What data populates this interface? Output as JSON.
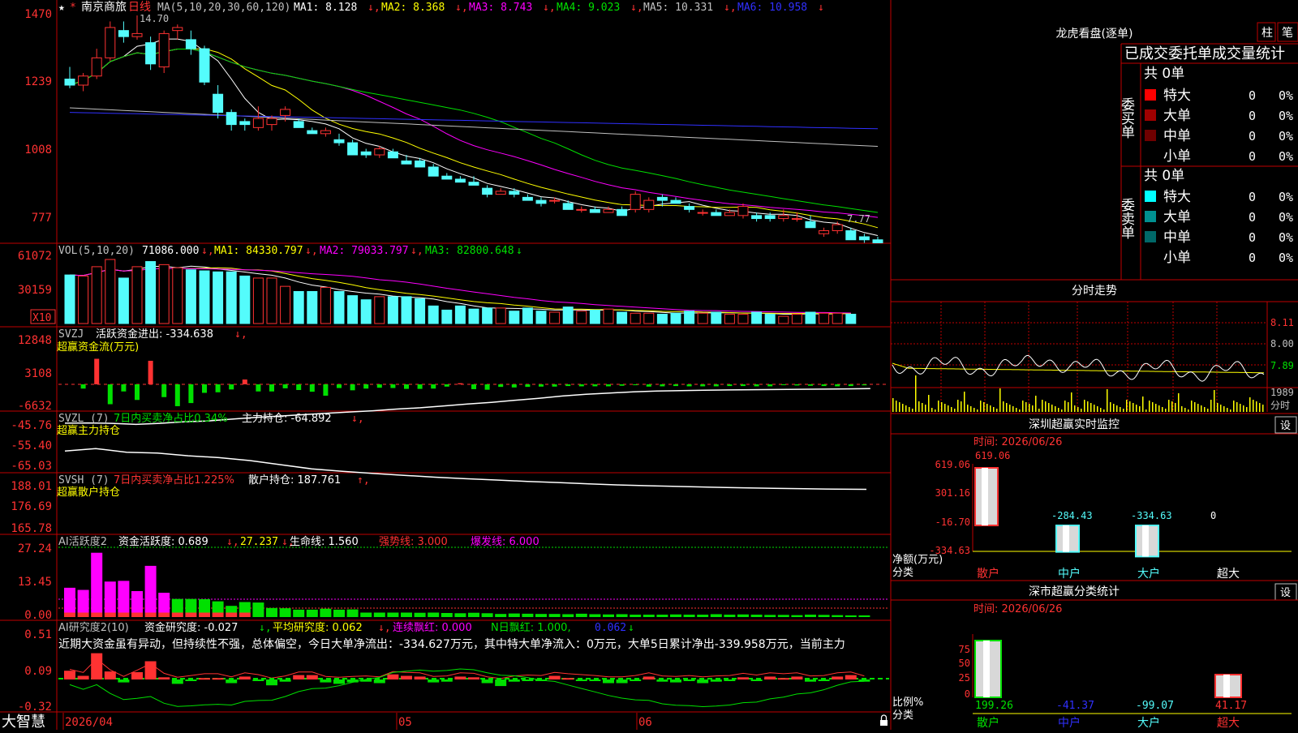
{
  "colors": {
    "up": "#ff3232",
    "down": "#54fcfc",
    "grid": "#c00000",
    "ma1": "#ffffff",
    "ma2": "#ffff00",
    "ma3": "#ff00ff",
    "ma4": "#00e000",
    "ma5": "#c0c0c0",
    "ma6": "#3030ff"
  },
  "stock": {
    "name": "南京商旅",
    "period": "日线"
  },
  "price_panel": {
    "header_prefix": "MA(5,10,20,30,60,120)",
    "ma_labels": [
      "MA1: 8.128",
      "MA2: 8.368",
      "MA3: 8.743",
      "MA4: 9.023",
      "MA5: 10.331",
      "MA6: 10.958"
    ],
    "ticks": [
      "1470",
      "1239",
      "1008",
      "777"
    ],
    "high_label": "14.70",
    "low_label": "7.77"
  },
  "vol_panel": {
    "header": "VOL(5,10,20)",
    "value": "71086.000",
    "ma_labels": [
      "MA1: 84330.797",
      "MA2: 79033.797",
      "MA3: 82800.648"
    ],
    "ticks": [
      "61072",
      "30159"
    ],
    "unit": "X10"
  },
  "svzj_panel": {
    "header": "SVZJ",
    "label": "活跃资金进出: -334.638",
    "sub": "超赢资金流(万元)",
    "ticks": [
      "12848",
      "3108",
      "-6632"
    ]
  },
  "svzl_panel": {
    "header": "SVZL (7)",
    "label1": "7日内买卖净占比0.34%",
    "label2": "主力持仓: -64.892",
    "sub": "超赢主力持仓",
    "ticks": [
      "-45.76",
      "-55.40",
      "-65.03"
    ]
  },
  "svsh_panel": {
    "header": "SVSH (7)",
    "label1": "7日内买卖净占比1.225%",
    "label2": "散户持仓: 187.761",
    "sub": "超赢散户持仓",
    "ticks": [
      "188.01",
      "176.69",
      "165.78"
    ]
  },
  "ai_active_panel": {
    "header": "AI活跃度2",
    "label1": "资金活跃度: 0.689",
    "label2": "27.237",
    "label3": "生命线: 1.560",
    "label4": "强势线: 3.000",
    "label5": "爆发线: 6.000",
    "ticks": [
      "27.24",
      "13.45",
      "0.00"
    ]
  },
  "ai_research_panel": {
    "header": "AI研究度2(10)",
    "label1": "资金研究度: -0.027",
    "label2": "平均研究度: 0.062",
    "label3": "连续飘红: 0.000",
    "label4": "N日飘红: 1.000,",
    "label5": "0.062",
    "text": "近期大资金虽有异动，但持续性不强，总体偏空，今日大单净流出：-334.627万元，其中特大单净流入：0万元，大单5日累计净出-339.958万元，当前主力",
    "ticks": [
      "0.51",
      "0.09",
      "-0.32"
    ]
  },
  "date_axis": {
    "labels": [
      "2026/04",
      "05",
      "06"
    ]
  },
  "footer": {
    "brand": "大智慧"
  },
  "dragon": {
    "title": "龙虎看盘(逐单)",
    "btn_col": "柱",
    "btn_pen": "笔",
    "table_title": "已成交委托单成交量统计",
    "buy": {
      "side_label": "委买单",
      "total": "共 0单",
      "rows": [
        {
          "label": "特大",
          "count": "0",
          "pct": "0%",
          "color": "#ff0000"
        },
        {
          "label": "大单",
          "count": "0",
          "pct": "0%",
          "color": "#a00000"
        },
        {
          "label": "中单",
          "count": "0",
          "pct": "0%",
          "color": "#700000"
        },
        {
          "label": "小单",
          "count": "0",
          "pct": "0%",
          "color": ""
        }
      ]
    },
    "sell": {
      "side_label": "委卖单",
      "total": "共 0单",
      "rows": [
        {
          "label": "特大",
          "count": "0",
          "pct": "0%",
          "color": "#00ffff"
        },
        {
          "label": "大单",
          "count": "0",
          "pct": "0%",
          "color": "#009090"
        },
        {
          "label": "中单",
          "count": "0",
          "pct": "0%",
          "color": "#006868"
        },
        {
          "label": "小单",
          "count": "0",
          "pct": "0%",
          "color": ""
        }
      ]
    }
  },
  "intraday": {
    "title": "分时走势",
    "ticks": [
      "8.11",
      "8.00",
      "7.89"
    ],
    "vol_tick": "1989",
    "vol_unit": "分时"
  },
  "monitor": {
    "title": "深圳超赢实时监控",
    "btn": "设",
    "date": "时间: 2026/06/26",
    "y_ticks": [
      "619.06",
      "301.16",
      "-16.70",
      "-334.63"
    ],
    "y_label": "净额(万元)",
    "x_label": "分类",
    "categories": [
      "散户",
      "中户",
      "大户",
      "超大"
    ],
    "values": [
      619.06,
      -284.43,
      -334.63,
      0
    ],
    "value_labels": [
      "619.06",
      "-284.43",
      "-334.63",
      "0"
    ]
  },
  "classify": {
    "title": "深市超赢分类统计",
    "btn": "设",
    "date": "时间: 2026/06/26",
    "y_ticks": [
      "75",
      "50",
      "25",
      "0"
    ],
    "y_label": "比例%",
    "x_label": "分类",
    "categories": [
      "散户",
      "中户",
      "大户",
      "超大"
    ],
    "bars": [
      100,
      0,
      0,
      40
    ],
    "value_labels": [
      "199.26",
      "-41.37",
      "-99.07",
      "41.17"
    ]
  },
  "chart_data": [
    {
      "type": "candlestick",
      "title": "南京商旅 日线",
      "y_unit": "price (tick labels scaled x100)",
      "ylim": [
        7.4,
        15.1
      ],
      "ohlc": [
        [
          12.6,
          13.0,
          12.3,
          12.4
        ],
        [
          12.4,
          12.8,
          12.2,
          12.7
        ],
        [
          12.7,
          13.6,
          12.6,
          13.3
        ],
        [
          13.3,
          14.5,
          13.2,
          14.3
        ],
        [
          14.2,
          14.5,
          13.8,
          14.0
        ],
        [
          14.0,
          14.7,
          13.9,
          14.1
        ],
        [
          13.8,
          14.0,
          12.9,
          13.1
        ],
        [
          13.0,
          14.2,
          12.8,
          14.1
        ],
        [
          14.2,
          14.4,
          13.9,
          14.3
        ],
        [
          13.9,
          14.2,
          13.4,
          13.6
        ],
        [
          13.6,
          13.7,
          12.4,
          12.5
        ],
        [
          12.1,
          12.4,
          11.3,
          11.5
        ],
        [
          11.5,
          11.6,
          10.9,
          11.1
        ],
        [
          11.2,
          11.3,
          10.9,
          11.1
        ],
        [
          11.0,
          11.7,
          10.9,
          11.3
        ],
        [
          11.1,
          11.4,
          10.9,
          11.3
        ],
        [
          11.4,
          11.7,
          11.2,
          11.6
        ],
        [
          11.2,
          11.3,
          11.0,
          11.0
        ],
        [
          10.9,
          11.0,
          10.8,
          10.8
        ],
        [
          10.8,
          11.0,
          10.7,
          10.9
        ],
        [
          10.6,
          10.8,
          10.4,
          10.5
        ],
        [
          10.5,
          10.6,
          10.1,
          10.1
        ],
        [
          10.2,
          10.3,
          10.0,
          10.1
        ],
        [
          10.1,
          10.4,
          10.0,
          10.3
        ],
        [
          10.2,
          10.3,
          10.0,
          10.0
        ],
        [
          9.9,
          10.1,
          9.8,
          9.8
        ],
        [
          9.9,
          10.0,
          9.7,
          9.7
        ],
        [
          9.7,
          9.8,
          9.4,
          9.4
        ],
        [
          9.4,
          9.5,
          9.3,
          9.3
        ],
        [
          9.3,
          9.4,
          9.2,
          9.2
        ],
        [
          9.2,
          9.4,
          9.1,
          9.1
        ],
        [
          9.0,
          9.1,
          8.7,
          8.8
        ],
        [
          8.8,
          9.0,
          8.8,
          8.9
        ],
        [
          8.9,
          9.0,
          8.7,
          8.8
        ],
        [
          8.7,
          8.8,
          8.6,
          8.6
        ],
        [
          8.6,
          8.7,
          8.4,
          8.5
        ],
        [
          8.6,
          8.7,
          8.5,
          8.6
        ],
        [
          8.5,
          8.6,
          8.3,
          8.3
        ],
        [
          8.3,
          8.4,
          8.2,
          8.3
        ],
        [
          8.3,
          8.4,
          8.2,
          8.2
        ],
        [
          8.2,
          8.4,
          8.2,
          8.3
        ],
        [
          8.3,
          8.4,
          8.1,
          8.1
        ],
        [
          8.3,
          8.9,
          8.2,
          8.8
        ],
        [
          8.3,
          8.7,
          8.2,
          8.6
        ],
        [
          8.7,
          8.8,
          8.4,
          8.6
        ],
        [
          8.6,
          8.7,
          8.5,
          8.5
        ],
        [
          8.4,
          8.5,
          8.2,
          8.3
        ],
        [
          8.2,
          8.3,
          8.1,
          8.2
        ],
        [
          8.2,
          8.3,
          8.1,
          8.1
        ],
        [
          8.1,
          8.3,
          8.1,
          8.2
        ],
        [
          8.1,
          8.5,
          8.0,
          8.4
        ],
        [
          8.1,
          8.2,
          7.9,
          8.0
        ],
        [
          8.1,
          8.2,
          7.9,
          8.0
        ],
        [
          8.0,
          8.3,
          7.9,
          8.1
        ],
        [
          8.0,
          8.2,
          7.9,
          8.0
        ],
        [
          7.9,
          8.1,
          7.7,
          7.7
        ],
        [
          7.5,
          7.7,
          7.4,
          7.6
        ],
        [
          7.6,
          7.9,
          7.5,
          7.8
        ],
        [
          7.6,
          7.7,
          7.3,
          7.3
        ],
        [
          7.4,
          7.5,
          7.2,
          7.3
        ],
        [
          7.3,
          7.4,
          7.2,
          7.2
        ]
      ]
    },
    {
      "type": "bar",
      "title": "VOL(5,10,20)",
      "values": [
        47,
        46,
        55,
        62,
        44,
        55,
        60,
        57,
        54,
        52,
        51,
        50,
        50,
        46,
        44,
        44,
        36,
        31,
        31,
        35,
        31,
        27,
        23,
        26,
        26,
        26,
        24,
        17,
        13,
        17,
        14,
        15,
        15,
        12,
        15,
        12,
        11,
        16,
        12,
        13,
        14,
        11,
        10,
        10,
        9,
        10,
        12,
        10,
        11,
        9,
        9,
        11,
        9,
        7,
        9,
        11,
        10,
        10,
        9
      ]
    },
    {
      "type": "bar",
      "title": "超赢资金流(万元)",
      "values": [
        0,
        -1500,
        9000,
        -7000,
        -2500,
        -5500,
        8300,
        -4500,
        -7700,
        -6600,
        -3000,
        -2800,
        -1800,
        1700,
        -2500,
        -2500,
        -1400,
        -2000,
        -2600,
        -4000,
        -1300,
        -2100,
        -1500,
        -1200,
        -1300,
        -1600,
        -1600,
        -1500,
        -800,
        400,
        -1700,
        -1900,
        -900,
        -1100,
        -900,
        -800,
        -800,
        -600,
        -700,
        -700,
        -700,
        -500,
        -300,
        -800,
        -700,
        -600,
        -700,
        -700,
        -700,
        -600,
        -600,
        -700,
        -700,
        -300,
        -400,
        -500,
        -600,
        -700,
        -600,
        -334
      ]
    },
    {
      "type": "line",
      "title": "超赢主力持仓",
      "y": [
        -48.5,
        -48.6,
        -48.4,
        -47.9,
        -48.4,
        -49.1,
        -49.5,
        -50.4,
        -51.2,
        -51.8,
        -52.5,
        -53.2,
        -53.8,
        -54.4,
        -55.2,
        -55.8,
        -56.7,
        -57.6,
        -58.4,
        -59.4,
        -60.3,
        -61.4,
        -62.2,
        -62.8,
        -63.4,
        -63.8,
        -64.0,
        -64.2,
        -64.3,
        -64.4,
        -64.5,
        -64.6,
        -64.7,
        -64.8,
        -64.9
      ]
    },
    {
      "type": "line",
      "title": "超赢散户持仓",
      "y": [
        167.6,
        166.3,
        168.2,
        168.7,
        170.1,
        171.1,
        172.6,
        174.8,
        177.0,
        178.3,
        179.4,
        180.4,
        181.4,
        182.2,
        182.9,
        183.6,
        184.2,
        184.9,
        185.5,
        185.9,
        186.3,
        186.7,
        187.0,
        187.3,
        187.5,
        187.7,
        187.8
      ]
    },
    {
      "type": "bar",
      "title": "AI活跃度2",
      "values": [
        12.3,
        11.4,
        27.0,
        14.9,
        15.2,
        10.9,
        21.5,
        10.2,
        7.6,
        7.6,
        7.5,
        6.6,
        4.7,
        6.3,
        6.1,
        3.8,
        3.7,
        3.1,
        3.1,
        3.5,
        3.1,
        3.2,
        2.7,
        2.4,
        2.3,
        2.1,
        1.8,
        1.9,
        1.7,
        1.6,
        1.8,
        1.6,
        1.3,
        1.5,
        1.4,
        1.3,
        1.3,
        1.2,
        1.4,
        1.2,
        1.1,
        1.2,
        1.0,
        1.0,
        1.0,
        1.1,
        1.0,
        1.0,
        1.2,
        1.0,
        1.1,
        1.0,
        0.9,
        0.9,
        0.8,
        1.0,
        0.9,
        0.8,
        0.7,
        0.7
      ],
      "lines": {
        "生命线": 1.56,
        "强势线": 3.0,
        "爆发线": 6.0
      }
    },
    {
      "type": "bar",
      "title": "AI研究度2(10)",
      "values": [
        0.12,
        0.05,
        0.36,
        0.11,
        -0.04,
        0.1,
        0.25,
        0.03,
        -0.06,
        -0.02,
        0.02,
        0.02,
        -0.05,
        0.04,
        0.0,
        -0.08,
        -0.03,
        0.06,
        0.06,
        -0.04,
        -0.06,
        -0.04,
        -0.03,
        -0.05,
        0.07,
        0.05,
        0.04,
        -0.04,
        -0.03,
        0.04,
        0.03,
        -0.05,
        -0.09,
        -0.03,
        -0.01,
        -0.02,
        0.05,
        0.02,
        0.0,
        -0.02,
        -0.05,
        -0.05,
        -0.02,
        0.04,
        -0.03,
        -0.04,
        -0.02,
        -0.05,
        -0.03,
        -0.02,
        0.03,
        -0.01,
        0.04,
        0.02,
        0.04,
        -0.03,
        -0.02,
        0.04,
        0.06,
        -0.03
      ]
    }
  ]
}
